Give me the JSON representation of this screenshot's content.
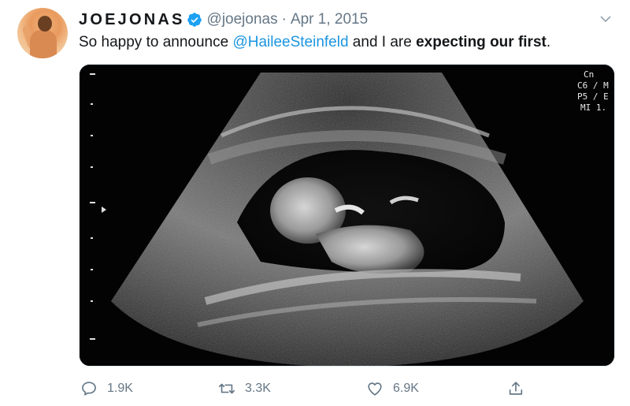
{
  "tweet": {
    "author": {
      "display_name": "JOEJONAS",
      "handle": "@joejonas",
      "verified": true
    },
    "separator": "·",
    "date": "Apr 1, 2015",
    "text": {
      "before": "So happy to announce ",
      "mention": "@HaileeSteinfeld",
      "middle": " and I are ",
      "bold": "expecting our first",
      "after": "."
    },
    "media": {
      "overlay_lines": [
        "Cn",
        "C6 / M",
        "P5 / E",
        "MI 1."
      ]
    },
    "actions": {
      "reply_count": "1.9K",
      "retweet_count": "3.3K",
      "like_count": "6.9K"
    }
  },
  "colors": {
    "text": "#14171a",
    "secondary": "#657786",
    "link": "#1b95e0",
    "verified_badge": "#1da1f2",
    "media_background": "#030303"
  },
  "icons": [
    "verified-badge-icon",
    "chevron-down-icon",
    "reply-icon",
    "retweet-icon",
    "like-icon",
    "share-icon"
  ]
}
